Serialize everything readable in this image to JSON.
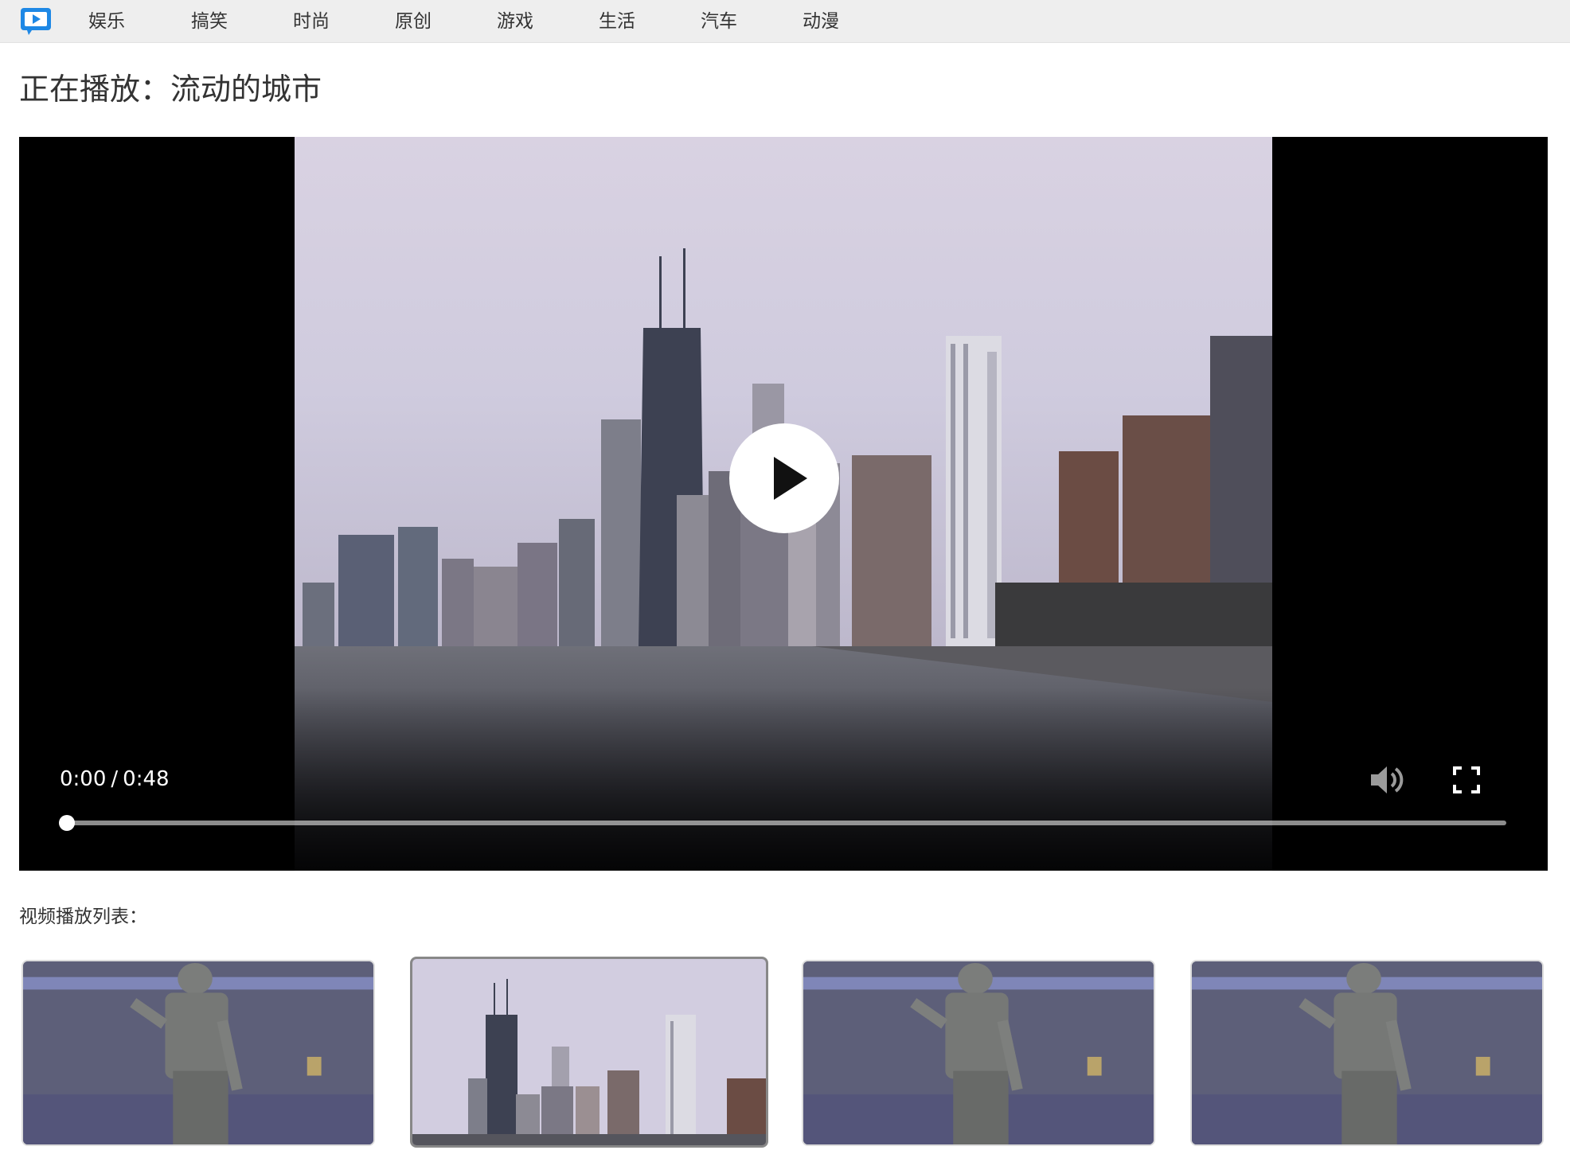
{
  "nav": {
    "items": [
      "娱乐",
      "搞笑",
      "时尚",
      "原创",
      "游戏",
      "生活",
      "汽车",
      "动漫"
    ],
    "icons": {
      "logo": "video-play-logo-icon"
    }
  },
  "page": {
    "title": "正在播放：流动的城市"
  },
  "player": {
    "current_time": "0:00",
    "separator": "/",
    "duration": "0:48",
    "progress": 0,
    "icons": {
      "play": "play-icon",
      "volume": "volume-icon",
      "fullscreen": "fullscreen-icon"
    }
  },
  "playlist": {
    "label": "视频播放列表：",
    "items": [
      {
        "thumbnail": "dancer",
        "active": false
      },
      {
        "thumbnail": "city-skyline",
        "active": true
      },
      {
        "thumbnail": "dancer",
        "active": false
      },
      {
        "thumbnail": "dancer",
        "active": false
      }
    ]
  },
  "colors": {
    "nav_background": "#eeeeee",
    "logo_blue": "#1e88e5",
    "player_background": "#000000",
    "text": "#333333",
    "active_border": "#888888"
  }
}
